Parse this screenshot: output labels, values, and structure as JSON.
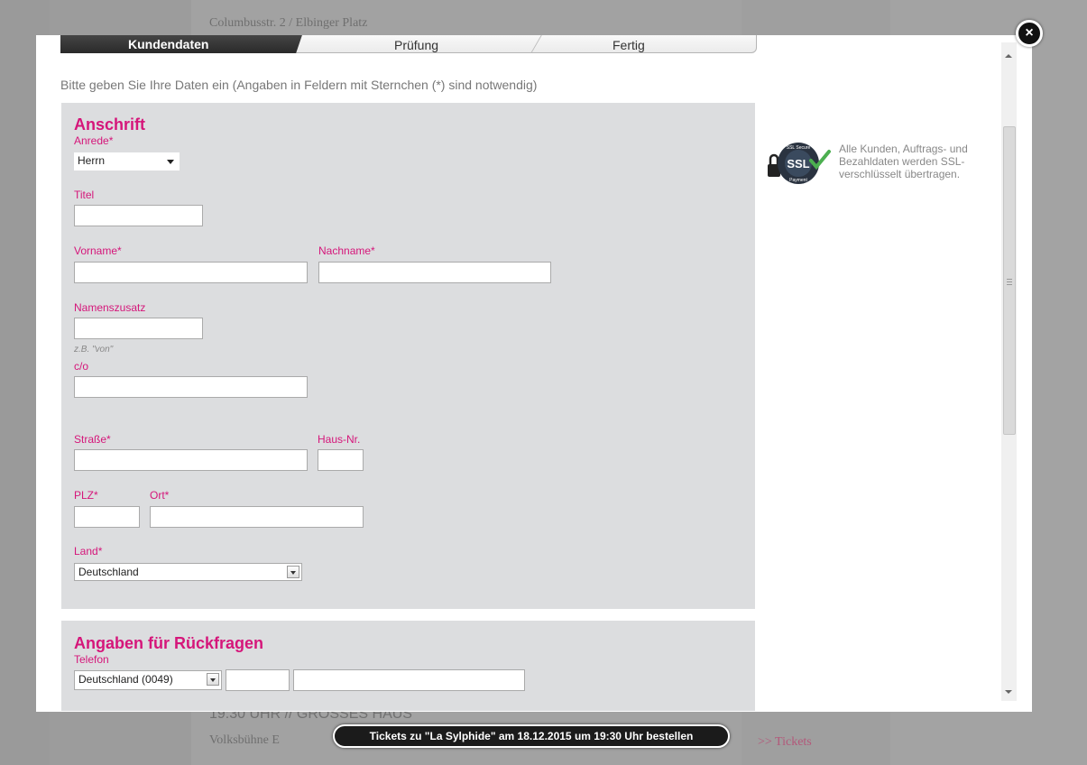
{
  "background": {
    "address": "Columbusstr. 2 / Elbinger Platz",
    "time_line": "19:30 UHR // GROSSES HAUS",
    "venue": "Volksbühne E",
    "tickets_link": ">> Tickets"
  },
  "modal": {
    "close_label": "×",
    "steps": [
      "Kundendaten",
      "Prüfung",
      "Fertig"
    ],
    "active_step": 0,
    "intro": "Bitte geben Sie Ihre Daten ein (Angaben in Feldern mit Sternchen (*) sind notwendig)",
    "address_section": {
      "title": "Anschrift",
      "salutation_label": "Anrede*",
      "salutation_value": "Herrn",
      "title_label": "Titel",
      "title_value": "",
      "firstname_label": "Vorname*",
      "firstname_value": "",
      "lastname_label": "Nachname*",
      "lastname_value": "",
      "name_suffix_label": "Namenszusatz",
      "name_suffix_value": "",
      "name_suffix_hint": "z.B. \"von\"",
      "co_label": "c/o",
      "co_value": "",
      "street_label": "Straße*",
      "street_value": "",
      "houseno_label": "Haus-Nr.",
      "houseno_value": "",
      "zip_label": "PLZ*",
      "zip_value": "",
      "city_label": "Ort*",
      "city_value": "",
      "country_label": "Land*",
      "country_value": "Deutschland"
    },
    "contact_section": {
      "title": "Angaben für Rückfragen",
      "phone_label": "Telefon",
      "phone_country_value": "Deutschland (0049)",
      "phone_area_value": "",
      "phone_number_value": ""
    },
    "ssl": {
      "badge_top": "SSL Secure",
      "badge_main": "SSL",
      "badge_bottom": "Payment",
      "text": "Alle Kunden, Auftrags- und Bezahldaten werden SSL-verschlüsselt übertragen."
    }
  },
  "order_bar": {
    "label": "Tickets zu \"La Sylphide\" am 18.12.2015 um 19:30 Uhr bestellen"
  },
  "colors": {
    "accent": "#d5167a",
    "panel": "#dcdddf"
  }
}
